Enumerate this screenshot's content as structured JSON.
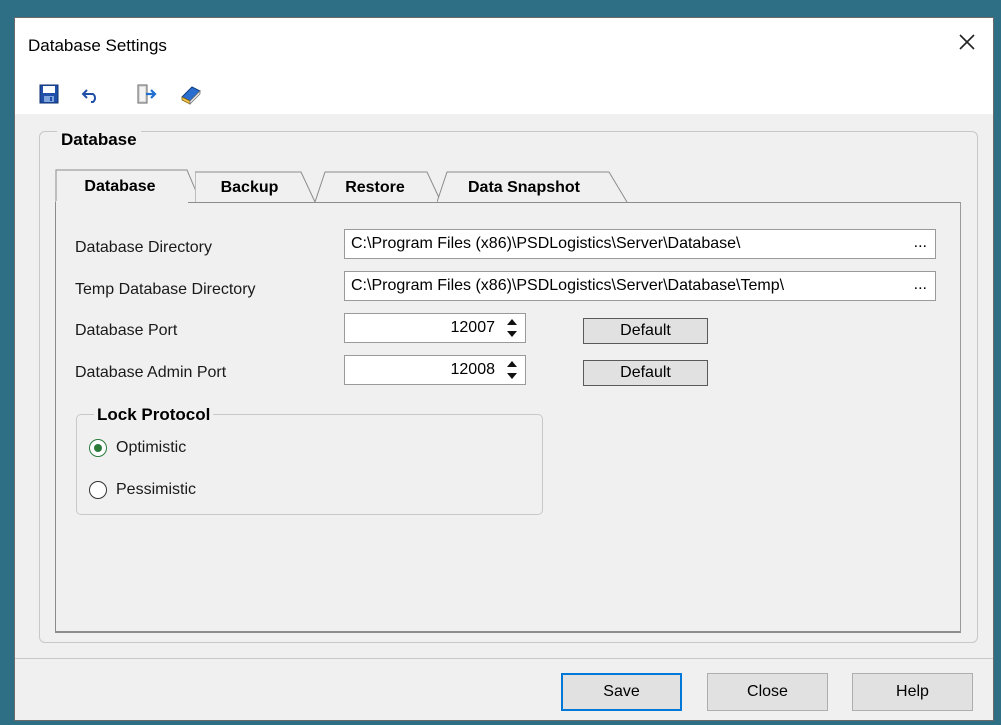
{
  "window": {
    "title": "Database Settings"
  },
  "toolbar": {
    "icons": [
      "save-icon",
      "undo-icon",
      "exit-icon",
      "help-book-icon"
    ]
  },
  "group": {
    "legend": "Database"
  },
  "tabs": [
    {
      "label": "Database",
      "active": true
    },
    {
      "label": "Backup",
      "active": false
    },
    {
      "label": "Restore",
      "active": false
    },
    {
      "label": "Data Snapshot",
      "active": false
    }
  ],
  "fields": {
    "db_dir": {
      "label": "Database Directory",
      "value": "C:\\Program Files (x86)\\PSDLogistics\\Server\\Database\\",
      "browse": "..."
    },
    "temp_dir": {
      "label": "Temp Database Directory",
      "value": "C:\\Program Files (x86)\\PSDLogistics\\Server\\Database\\Temp\\",
      "browse": "..."
    },
    "db_port": {
      "label": "Database Port",
      "value": "12007",
      "default_label": "Default"
    },
    "admin_port": {
      "label": "Database Admin Port",
      "value": "12008",
      "default_label": "Default"
    }
  },
  "lock_protocol": {
    "legend": "Lock Protocol",
    "options": [
      {
        "label": "Optimistic",
        "selected": true
      },
      {
        "label": "Pessimistic",
        "selected": false
      }
    ]
  },
  "buttons": {
    "save": "Save",
    "close": "Close",
    "help": "Help"
  },
  "colors": {
    "accent": "#0078d7",
    "radio_selected": "#2b7a3a",
    "desktop": "#2e6f86"
  }
}
